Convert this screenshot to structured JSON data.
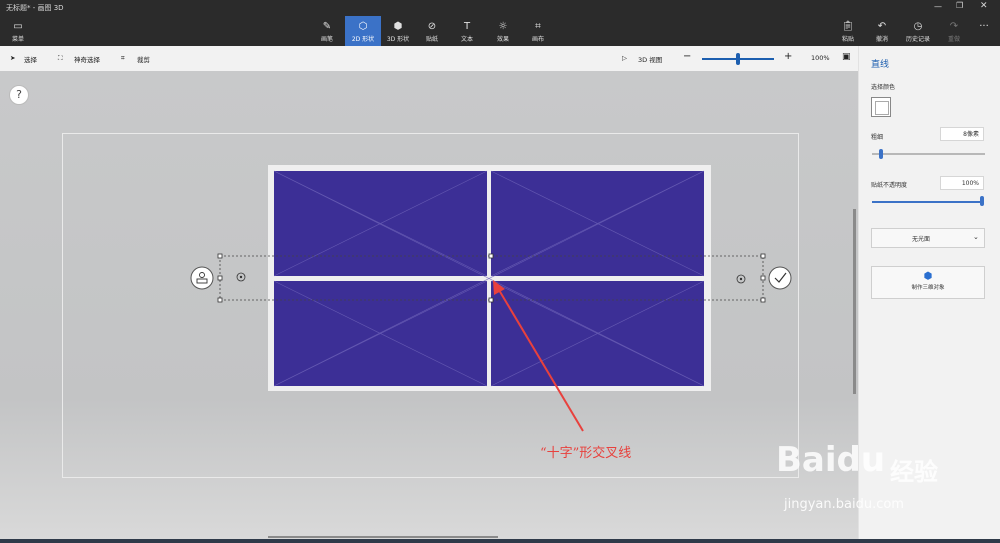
{
  "window": {
    "title": "无标题* - 画图 3D"
  },
  "ribbon": {
    "menu": "菜单",
    "tools": [
      {
        "label": "画笔",
        "icon": "brush-icon"
      },
      {
        "label": "2D 形状",
        "icon": "2d-shapes-icon"
      },
      {
        "label": "3D 形状",
        "icon": "3d-shapes-icon"
      },
      {
        "label": "贴纸",
        "icon": "stickers-icon"
      },
      {
        "label": "文本",
        "icon": "text-icon"
      },
      {
        "label": "效果",
        "icon": "effects-icon"
      },
      {
        "label": "画布",
        "icon": "canvas-icon"
      }
    ],
    "paste": "粘贴",
    "undo": "撤消",
    "history": "历史记录",
    "redo": "重做"
  },
  "toolbar": {
    "select": "选择",
    "magic_select": "神奇选择",
    "crop": "裁剪",
    "view3d": "3D 视图",
    "zoom": "100%",
    "zoom_fraction": 0.5
  },
  "canvas": {
    "help": "?",
    "annotation": "“十字”形交叉线",
    "table_color": "#3c2f96",
    "arrow_color": "#e8413d"
  },
  "panel": {
    "title": "直线",
    "select_color": "选择颜色",
    "thickness_label": "粗细",
    "thickness_value": "8像素",
    "thickness_fraction": 0.08,
    "opacity_label": "贴纸不透明度",
    "opacity_value": "100%",
    "opacity_fraction": 1.0,
    "cap_option": "无光面",
    "make3d": "制作三维对象"
  },
  "watermark": {
    "brand": "Bai",
    "brand2": "du",
    "cn": "经验",
    "url": "jingyan.baidu.com"
  }
}
